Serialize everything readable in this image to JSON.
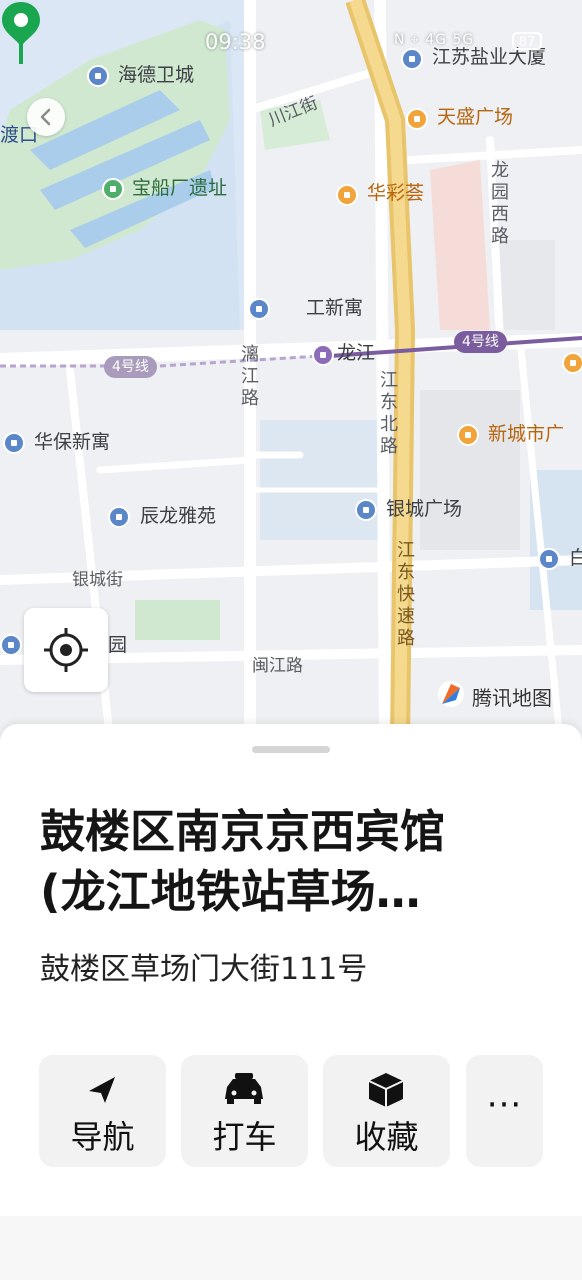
{
  "status_bar": {
    "time": "09:38",
    "indicators": "N ⌖ 4G 5G",
    "battery": "87"
  },
  "map": {
    "pois": [
      {
        "name": "海德卫城",
        "icon": "building-icon",
        "color": "#5b87c9"
      },
      {
        "name": "宝船厂遗址",
        "icon": "scenic-icon",
        "color": "#4fae6a"
      },
      {
        "name": "江苏盐业大厦",
        "icon": "office-icon",
        "color": "#5b87c9"
      },
      {
        "name": "天盛广场",
        "icon": "mall-icon",
        "color": "#f0a43a"
      },
      {
        "name": "华彩荟",
        "icon": "mall-icon",
        "color": "#f0a43a"
      },
      {
        "name": "工新寓",
        "icon": "building-icon",
        "color": "#5b87c9"
      },
      {
        "name": "龙江",
        "icon": "metro-station-icon",
        "color": "#8c6bb8"
      },
      {
        "name": "华保新寓",
        "icon": "building-icon",
        "color": "#5b87c9"
      },
      {
        "name": "新城市广",
        "icon": "mall-icon",
        "color": "#f0a43a"
      },
      {
        "name": "辰龙雅苑",
        "icon": "office-icon",
        "color": "#5b87c9"
      },
      {
        "name": "银城广场",
        "icon": "office-icon",
        "color": "#5b87c9"
      },
      {
        "name": "园",
        "icon": "building-icon",
        "color": "#5b87c9"
      },
      {
        "name": "白",
        "icon": "building-icon",
        "color": "#5b87c9"
      },
      {
        "name": "渡口",
        "icon": "",
        "color": "#5b87c9"
      }
    ],
    "roads": {
      "chuanjiang": "川江街",
      "longyuan_west": "龙园西路",
      "lijiang": "漓江路",
      "jiangdong_north": "江东北路",
      "jiangdong_express": "江东快速路",
      "yincheng": "银城街",
      "minjiang": "闽江路"
    },
    "metro_line_left": "4号线",
    "metro_line_right": "4号线",
    "metro_color": "#7b5c9e",
    "brand": "腾讯地图"
  },
  "place": {
    "name": "鼓楼区南京京西宾馆(龙江地铁站草场…",
    "name_line1": "鼓楼区南京京西宾馆",
    "name_line2": "(龙江地铁站草场…",
    "address": "鼓楼区草场门大街111号",
    "pin_color": "#1aa64f"
  },
  "actions": {
    "navigate": "导航",
    "taxi": "打车",
    "favorite": "收藏",
    "more": "···"
  }
}
